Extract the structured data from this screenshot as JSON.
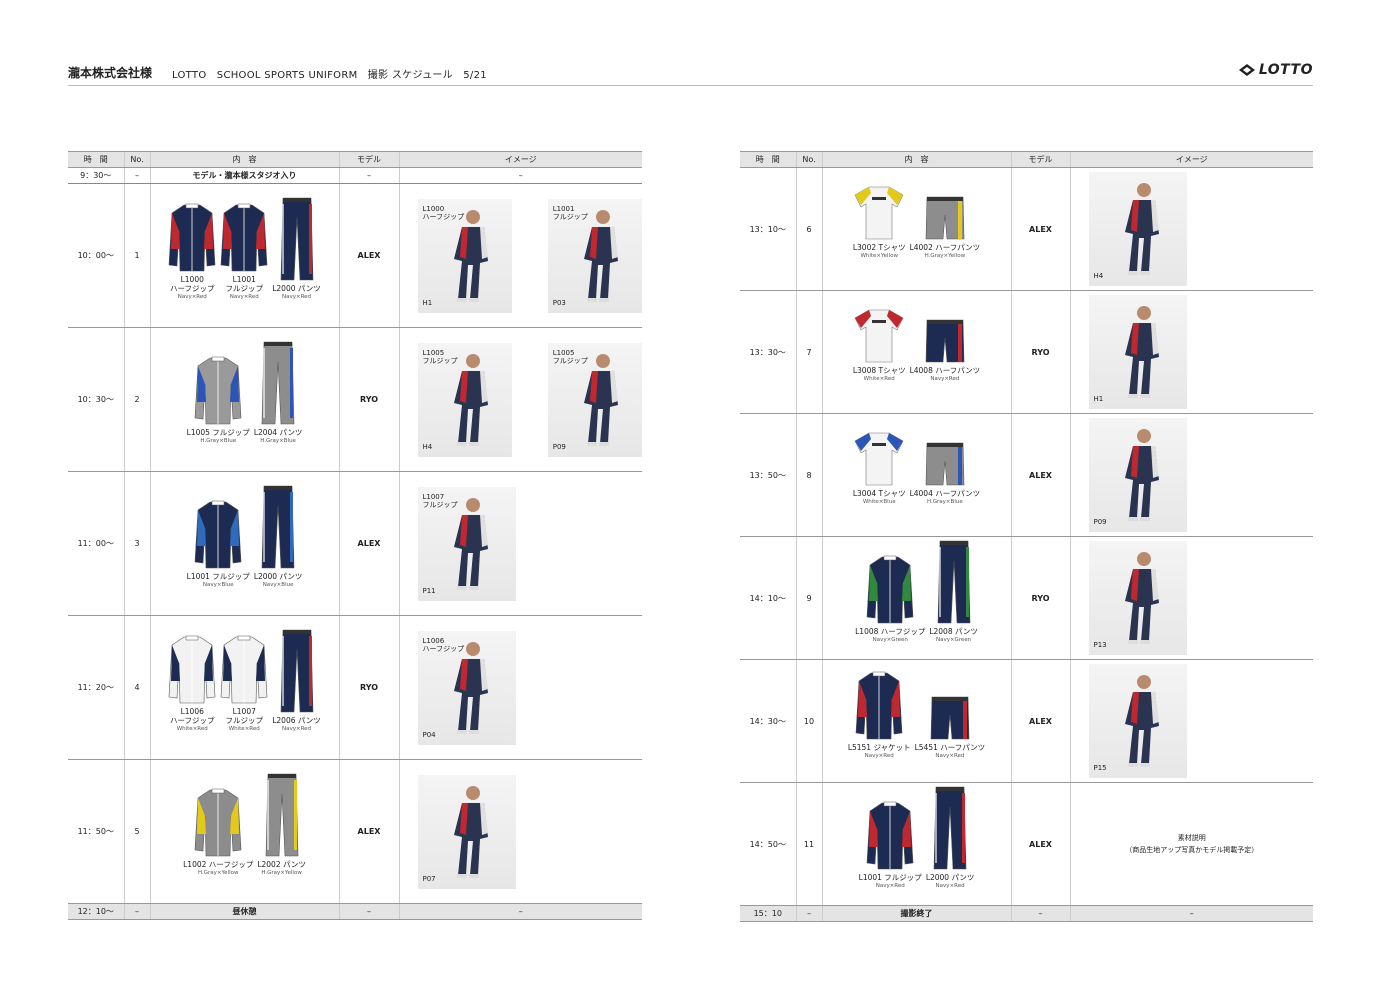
{
  "header": {
    "client": "瀧本株式会社様",
    "subtitle": "LOTTO　SCHOOL SPORTS UNIFORM　撮影 スケジュール　5/21",
    "logo": "LOTTO"
  },
  "columns": {
    "time": "時　間",
    "no": "No.",
    "content": "内　容",
    "model": "モデル",
    "image": "イメージ"
  },
  "left": {
    "start": {
      "time": "9：30〜",
      "no": "–",
      "content": "モデル・瀧本様スタジオ入り",
      "model": "–",
      "image": "–"
    },
    "rows": [
      {
        "time": "10：00〜",
        "no": "1",
        "model": "ALEX",
        "products": [
          {
            "l1": "L1000",
            "l2": "ハーフジップ",
            "c": "Navy×Red",
            "kind": "jacket",
            "col": "#1d2a52",
            "acc": "#c0282f"
          },
          {
            "l1": "L1001",
            "l2": "フルジップ",
            "c": "Navy×Red",
            "kind": "jacket",
            "col": "#1d2a52",
            "acc": "#c0282f"
          },
          {
            "l1": "L2000 パンツ",
            "c": "Navy×Red",
            "kind": "pants",
            "col": "#1d2a52",
            "acc": "#c0282f"
          }
        ],
        "images": [
          {
            "l1": "L1000",
            "l2": "ハーフジップ",
            "code": "H1"
          },
          {
            "l1": "L1001",
            "l2": "フルジップ",
            "code": "P03"
          }
        ]
      },
      {
        "time": "10：30〜",
        "no": "2",
        "model": "RYO",
        "products": [
          {
            "l1": "L1005 フルジップ",
            "c": "H.Gray×Blue",
            "kind": "jacket",
            "col": "#9a9a9a",
            "acc": "#2c55b5"
          },
          {
            "l1": "L2004 パンツ",
            "c": "H.Gray×Blue",
            "kind": "pants",
            "col": "#8d8d8d",
            "acc": "#2c55b5"
          }
        ],
        "images": [
          {
            "l1": "L1005",
            "l2": "フルジップ",
            "code": "H4"
          },
          {
            "l1": "L1005",
            "l2": "フルジップ",
            "code": "P09"
          }
        ]
      },
      {
        "time": "11：00〜",
        "no": "3",
        "model": "ALEX",
        "products": [
          {
            "l1": "L1001 フルジップ",
            "c": "Navy×Blue",
            "kind": "jacket",
            "col": "#1d2a52",
            "acc": "#2e6bbd"
          },
          {
            "l1": "L2000 パンツ",
            "c": "Navy×Blue",
            "kind": "pants",
            "col": "#1d2a52",
            "acc": "#2e6bbd"
          }
        ],
        "images": [
          {
            "l1": "L1007",
            "l2": "フルジップ",
            "code": "P11"
          }
        ]
      },
      {
        "time": "11：20〜",
        "no": "4",
        "model": "RYO",
        "products": [
          {
            "l1": "L1006",
            "l2": "ハーフジップ",
            "c": "White×Red",
            "kind": "jacket",
            "col": "#f2f2f2",
            "acc": "#1d2a52"
          },
          {
            "l1": "L1007",
            "l2": "フルジップ",
            "c": "White×Red",
            "kind": "jacket",
            "col": "#f2f2f2",
            "acc": "#1d2a52"
          },
          {
            "l1": "L2006 パンツ",
            "c": "Navy×Red",
            "kind": "pants",
            "col": "#1d2a52",
            "acc": "#c0282f"
          }
        ],
        "images": [
          {
            "l1": "L1006",
            "l2": "ハーフジップ",
            "code": "P04"
          }
        ]
      },
      {
        "time": "11：50〜",
        "no": "5",
        "model": "ALEX",
        "products": [
          {
            "l1": "L1002 ハーフジップ",
            "c": "H.Gray×Yellow",
            "kind": "jacket",
            "col": "#8c8c8c",
            "acc": "#e3c91c"
          },
          {
            "l1": "L2002 パンツ",
            "c": "H.Gray×Yellow",
            "kind": "pants",
            "col": "#8d8d8d",
            "acc": "#e3c91c"
          }
        ],
        "images": [
          {
            "l1": "",
            "l2": "",
            "code": "P07"
          }
        ]
      }
    ],
    "end": {
      "time": "12：10〜",
      "no": "–",
      "content": "昼休憩",
      "model": "–",
      "image": "–"
    }
  },
  "right": {
    "rows": [
      {
        "time": "13：10〜",
        "no": "6",
        "model": "ALEX",
        "products": [
          {
            "l1": "L3002 Tシャツ",
            "c": "White×Yellow",
            "kind": "tee",
            "col": "#f4f4f4",
            "acc": "#e3c91c"
          },
          {
            "l1": "L4002 ハーフパンツ",
            "c": "H.Gray×Yellow",
            "kind": "shorts",
            "col": "#8d8d8d",
            "acc": "#e3c91c"
          }
        ],
        "images": [
          {
            "l1": "",
            "l2": "",
            "code": "H4"
          }
        ]
      },
      {
        "time": "13：30〜",
        "no": "7",
        "model": "RYO",
        "products": [
          {
            "l1": "L3008 Tシャツ",
            "c": "White×Red",
            "kind": "tee",
            "col": "#f4f4f4",
            "acc": "#c0282f"
          },
          {
            "l1": "L4008 ハーフパンツ",
            "c": "Navy×Red",
            "kind": "shorts",
            "col": "#1d2a52",
            "acc": "#c0282f"
          }
        ],
        "images": [
          {
            "l1": "",
            "l2": "",
            "code": "H1"
          }
        ]
      },
      {
        "time": "13：50〜",
        "no": "8",
        "model": "ALEX",
        "products": [
          {
            "l1": "L3004 Tシャツ",
            "c": "White×Blue",
            "kind": "tee",
            "col": "#f4f4f4",
            "acc": "#2c55b5"
          },
          {
            "l1": "L4004 ハーフパンツ",
            "c": "H.Gray×Blue",
            "kind": "shorts",
            "col": "#8d8d8d",
            "acc": "#2c55b5"
          }
        ],
        "images": [
          {
            "l1": "",
            "l2": "",
            "code": "P09"
          }
        ]
      },
      {
        "time": "14：10〜",
        "no": "9",
        "model": "RYO",
        "products": [
          {
            "l1": "L1008 ハーフジップ",
            "c": "Navy×Green",
            "kind": "jacket",
            "col": "#1d2a52",
            "acc": "#2f8a3c"
          },
          {
            "l1": "L2008 パンツ",
            "c": "Navy×Green",
            "kind": "pants",
            "col": "#1d2a52",
            "acc": "#2f8a3c"
          }
        ],
        "images": [
          {
            "l1": "",
            "l2": "",
            "code": "P13"
          }
        ]
      },
      {
        "time": "14：30〜",
        "no": "10",
        "model": "ALEX",
        "products": [
          {
            "l1": "L5151 ジャケット",
            "c": "Navy×Red",
            "kind": "jacket",
            "col": "#1d2a52",
            "acc": "#c0282f"
          },
          {
            "l1": "L5451 ハーフパンツ",
            "c": "Navy×Red",
            "kind": "shorts",
            "col": "#1d2a52",
            "acc": "#c0282f"
          }
        ],
        "images": [
          {
            "l1": "",
            "l2": "",
            "code": "P15"
          }
        ]
      },
      {
        "time": "14：50〜",
        "no": "11",
        "model": "ALEX",
        "products": [
          {
            "l1": "L1001 フルジップ",
            "c": "Navy×Red",
            "kind": "jacket",
            "col": "#1d2a52",
            "acc": "#c0282f"
          },
          {
            "l1": "L2000 パンツ",
            "c": "Navy×Red",
            "kind": "pants",
            "col": "#1d2a52",
            "acc": "#c0282f"
          }
        ],
        "images": [],
        "note": {
          "l1": "素材説明",
          "l2": "（商品生地アップ写真かモデル掲載予定）"
        }
      }
    ],
    "end": {
      "time": "15：10",
      "no": "–",
      "content": "撮影終了",
      "model": "–",
      "image": "–"
    }
  }
}
